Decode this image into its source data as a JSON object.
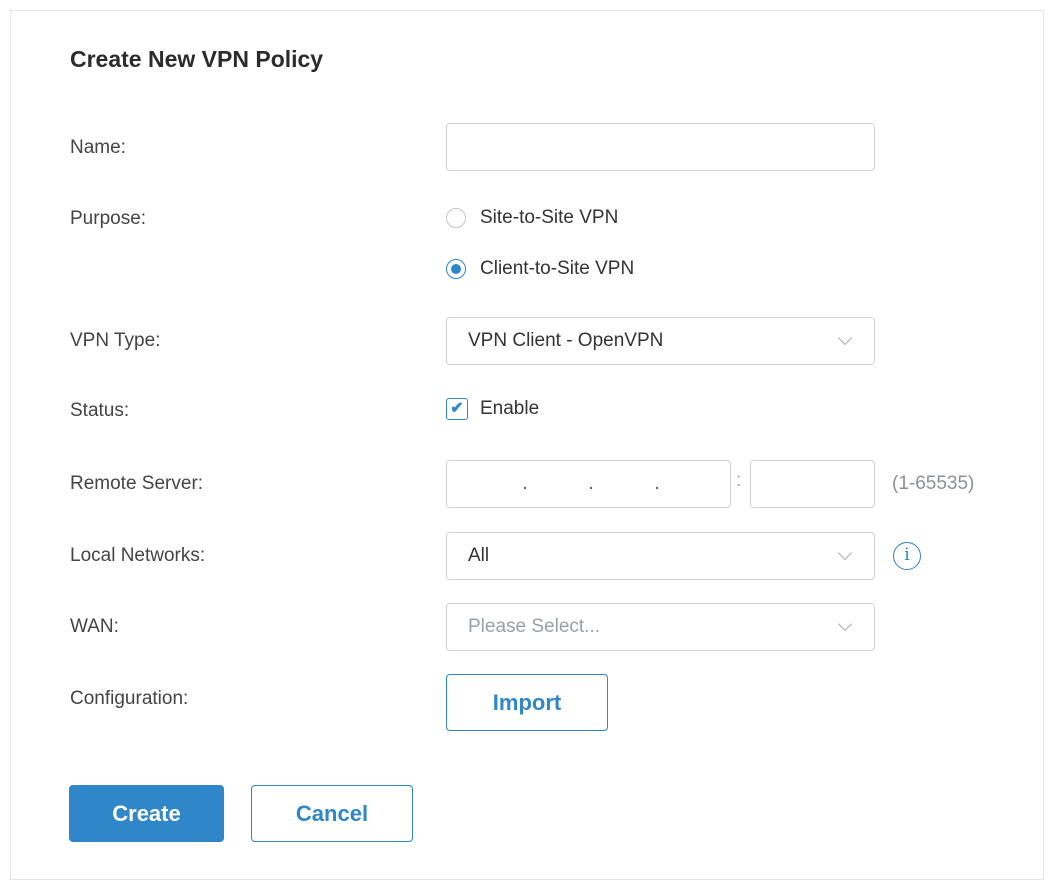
{
  "dialog": {
    "title": "Create New VPN Policy"
  },
  "form": {
    "name": {
      "label": "Name:",
      "value": ""
    },
    "purpose": {
      "label": "Purpose:",
      "options": [
        {
          "label": "Site-to-Site VPN",
          "checked": false
        },
        {
          "label": "Client-to-Site VPN",
          "checked": true
        }
      ]
    },
    "vpn_type": {
      "label": "VPN Type:",
      "value": "VPN Client - OpenVPN"
    },
    "status": {
      "label": "Status:",
      "checkbox_label": "Enable",
      "checked": true
    },
    "remote_server": {
      "label": "Remote Server:",
      "ip_separators": [
        ".",
        ".",
        "."
      ],
      "colon": ":",
      "port_value": "",
      "port_hint": "(1-65535)"
    },
    "local_networks": {
      "label": "Local Networks:",
      "value": "All",
      "info_icon": "info-icon"
    },
    "wan": {
      "label": "WAN:",
      "placeholder": "Please Select..."
    },
    "configuration": {
      "label": "Configuration:",
      "button_label": "Import"
    }
  },
  "actions": {
    "create_label": "Create",
    "cancel_label": "Cancel"
  },
  "colors": {
    "accent": "#2f86c9",
    "border": "#cfd3d8",
    "placeholder": "#9aa0a6"
  }
}
